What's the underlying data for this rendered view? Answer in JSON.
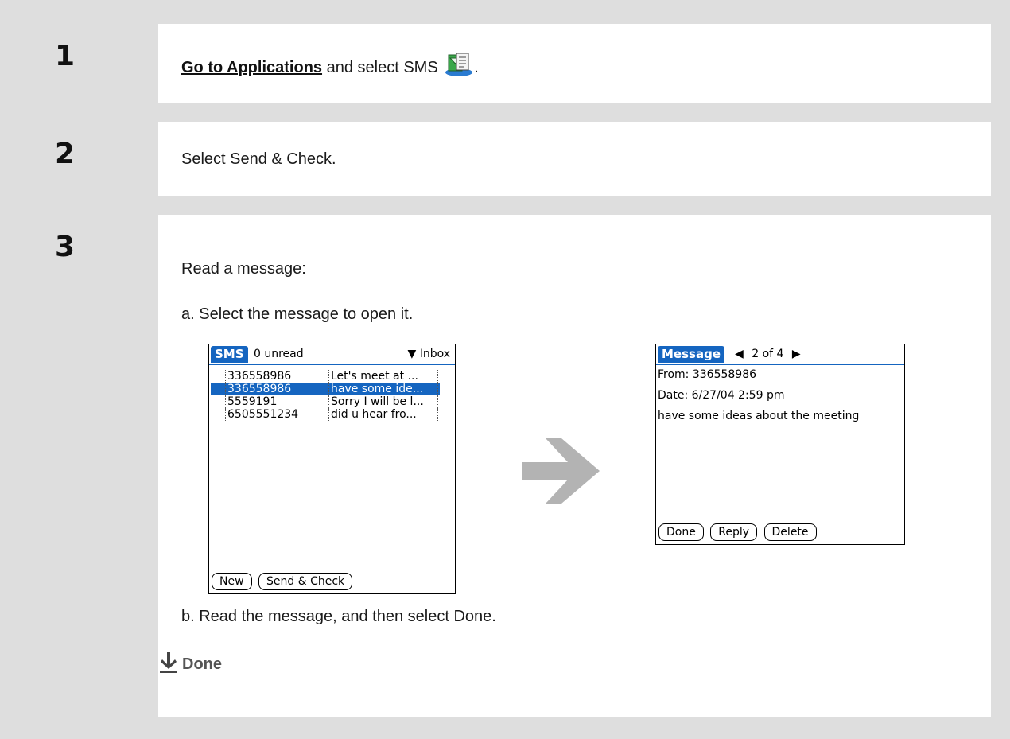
{
  "steps": [
    {
      "number": "1",
      "link": "Go to Applications",
      "text_after": " and select SMS",
      "icon": "sms-app-icon",
      "end": "."
    },
    {
      "number": "2",
      "text": "Select Send & Check."
    },
    {
      "number": "3",
      "text": "Read a message:",
      "sub_a": "a.  Select the message to open it.",
      "sub_b": "b.  Read the message, and then select Done."
    }
  ],
  "sms_screen": {
    "tab": "SMS",
    "unread": "0 unread",
    "folder": "Inbox",
    "rows": [
      {
        "number": "336558986",
        "message": "Let's meet at ..."
      },
      {
        "number": "336558986",
        "message": "have some ide...",
        "selected": true
      },
      {
        "number": "5559191",
        "message": "Sorry I will be l..."
      },
      {
        "number": "6505551234",
        "message": "did u hear fro..."
      }
    ],
    "buttons": [
      "New",
      "Send & Check"
    ]
  },
  "message_screen": {
    "tab": "Message",
    "pager": "2 of 4",
    "from": "From:  336558986",
    "date": "Date:  6/27/04 2:59 pm",
    "body": "have some ideas about the meeting",
    "buttons": [
      "Done",
      "Reply",
      "Delete"
    ]
  },
  "done_label": "Done",
  "colors": {
    "palm_blue": "#1565c0",
    "arrow_gray": "#b3b3b3"
  }
}
